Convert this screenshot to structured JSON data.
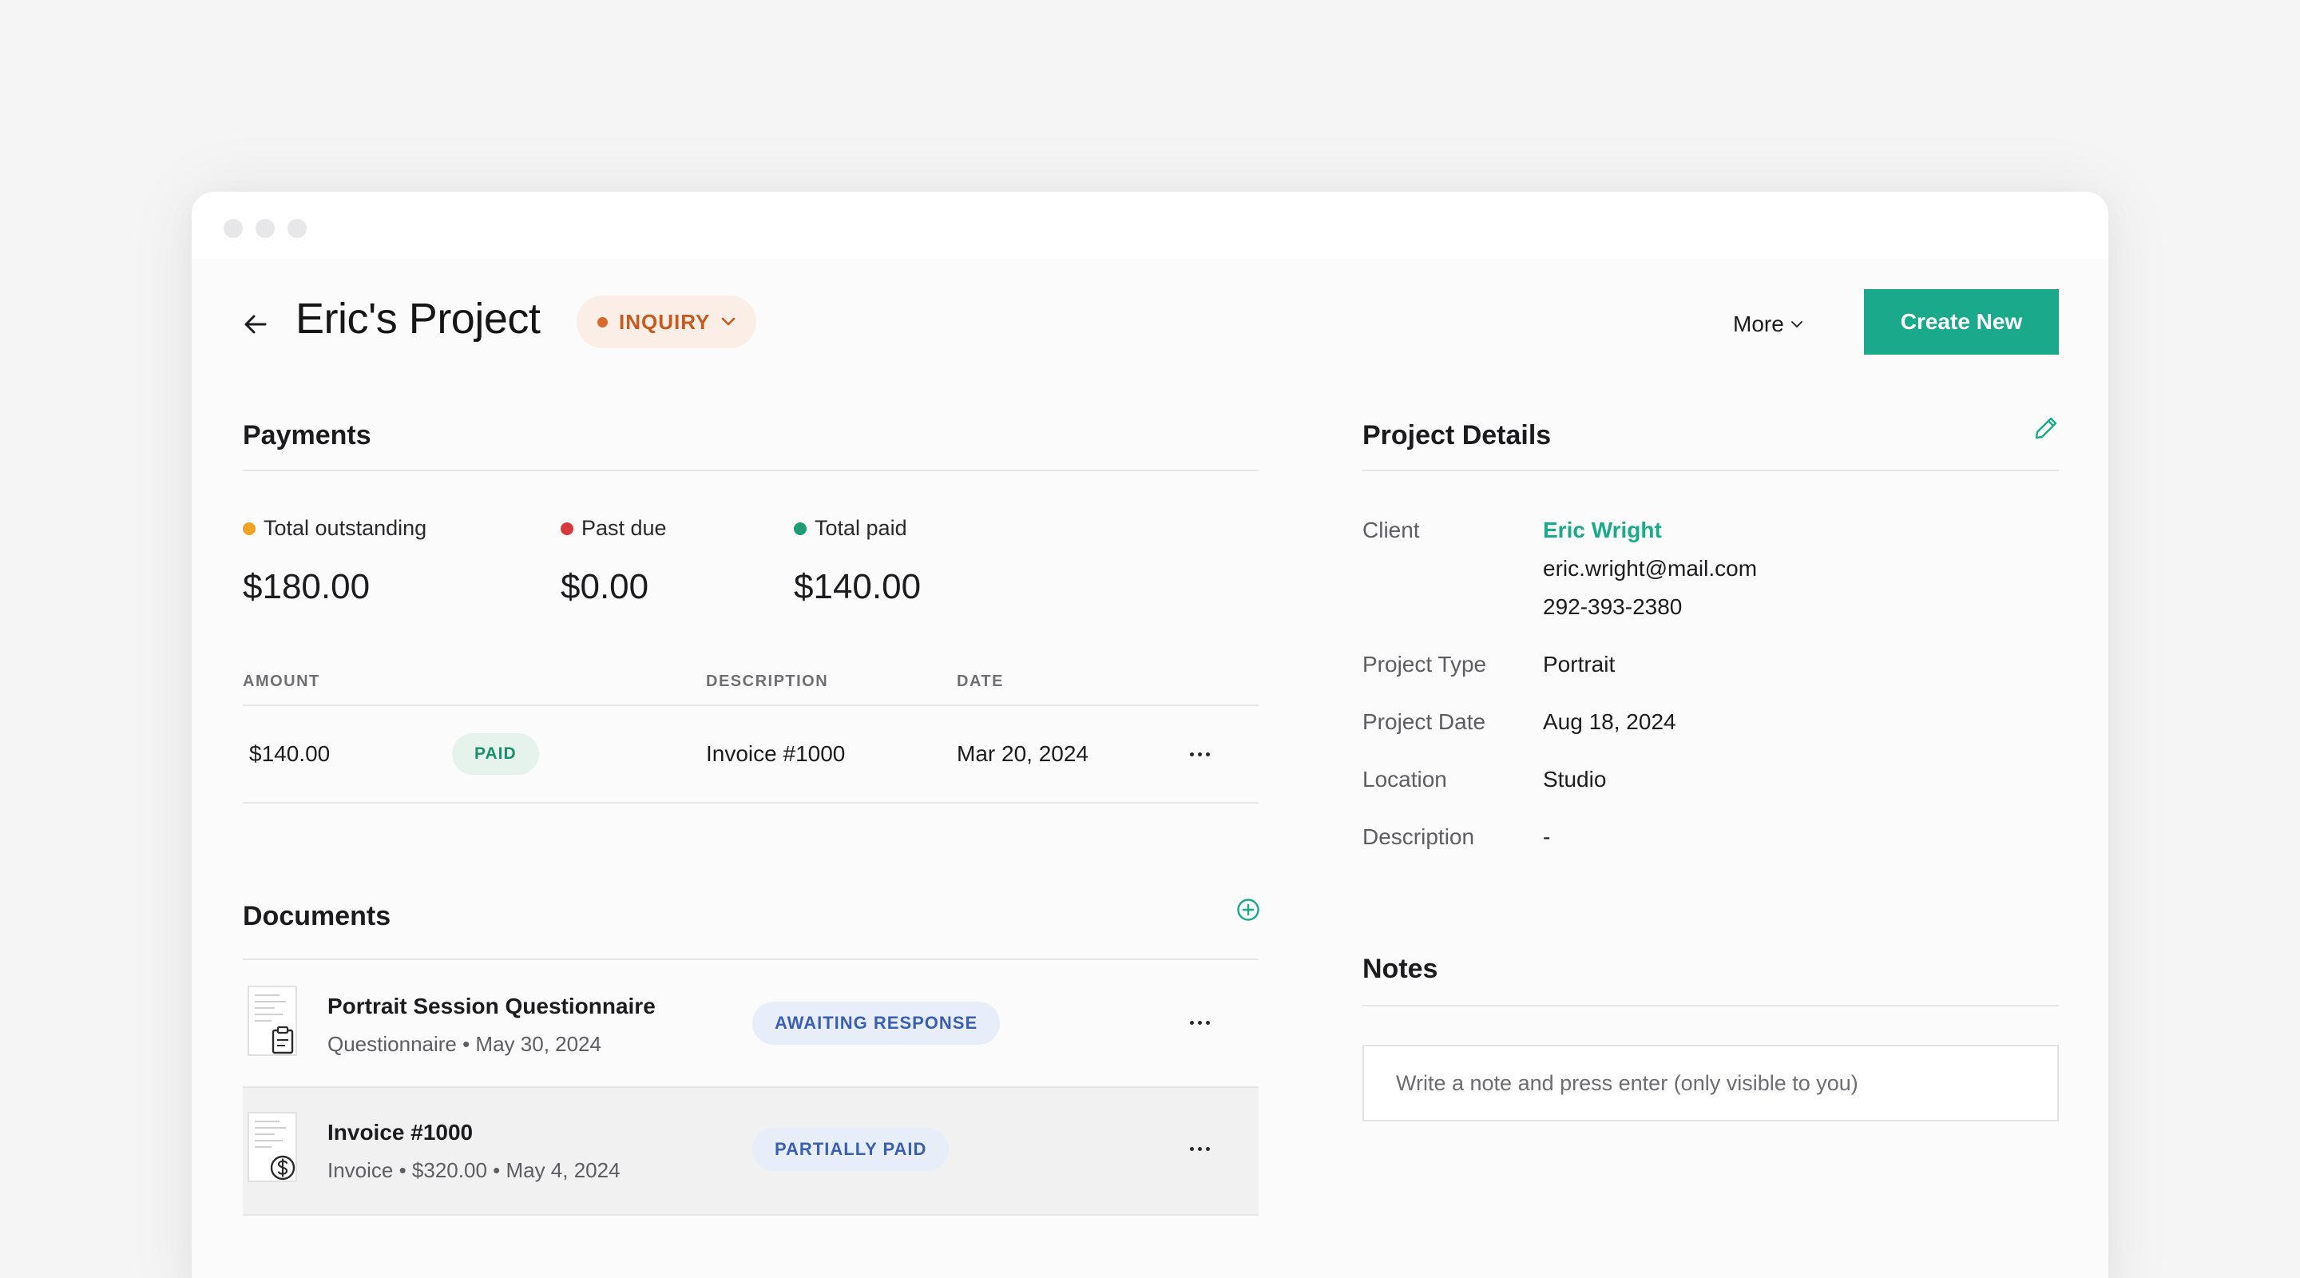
{
  "header": {
    "title": "Eric's Project",
    "status": "INQUIRY",
    "more_label": "More",
    "create_label": "Create New"
  },
  "payments": {
    "title": "Payments",
    "summary": [
      {
        "label": "Total outstanding",
        "value": "$180.00",
        "color": "#f0a322"
      },
      {
        "label": "Past due",
        "value": "$0.00",
        "color": "#d63b3b"
      },
      {
        "label": "Total paid",
        "value": "$140.00",
        "color": "#1f9a72"
      }
    ],
    "columns": {
      "amount": "AMOUNT",
      "description": "DESCRIPTION",
      "date": "DATE"
    },
    "rows": [
      {
        "amount": "$140.00",
        "status": "PAID",
        "description": "Invoice #1000",
        "date": "Mar 20, 2024"
      }
    ]
  },
  "documents": {
    "title": "Documents",
    "items": [
      {
        "title": "Portrait Session Questionnaire",
        "meta": "Questionnaire • May 30, 2024",
        "status": "AWAITING RESPONSE",
        "icon": "clipboard-icon"
      },
      {
        "title": "Invoice #1000",
        "meta": "Invoice • $320.00 • May 4, 2024",
        "status": "PARTIALLY PAID",
        "icon": "dollar-icon"
      }
    ]
  },
  "details": {
    "title": "Project Details",
    "client_label": "Client",
    "client_name": "Eric Wright",
    "client_email": "eric.wright@mail.com",
    "client_phone": "292-393-2380",
    "fields": [
      {
        "label": "Project Type",
        "value": "Portrait"
      },
      {
        "label": "Project Date",
        "value": "Aug 18, 2024"
      },
      {
        "label": "Location",
        "value": "Studio"
      },
      {
        "label": "Description",
        "value": "-"
      }
    ]
  },
  "notes": {
    "title": "Notes",
    "placeholder": "Write a note and press enter (only visible to you)"
  },
  "colors": {
    "accent": "#1aa98a",
    "inquiry": "#c55b20",
    "paid": "#1b8f6e",
    "doc_badge": "#3a5fb0"
  }
}
